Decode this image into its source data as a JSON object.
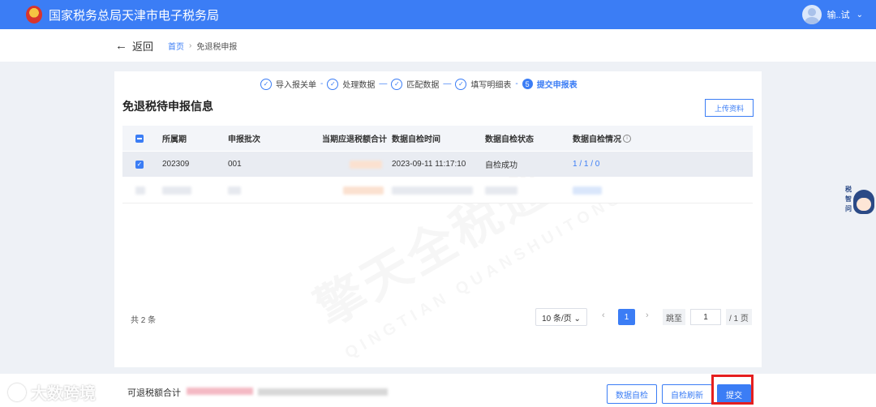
{
  "header": {
    "site_title": "国家税务总局天津市电子税务局",
    "user_name": "输..试",
    "chevron": "⌄"
  },
  "nav": {
    "back_label": "返回",
    "back_arrow": "←",
    "breadcrumb_home": "首页",
    "breadcrumb_sep": "›",
    "breadcrumb_current": "免退税申报"
  },
  "steps": [
    {
      "label": "导入报关单",
      "state": "done"
    },
    {
      "label": "处理数据",
      "state": "done"
    },
    {
      "label": "匹配数据",
      "state": "done"
    },
    {
      "label": "填写明细表",
      "state": "done"
    },
    {
      "label": "提交申报表",
      "state": "active",
      "number": "5"
    }
  ],
  "panel": {
    "title": "免退税待申报信息",
    "upload_button": "上传资料"
  },
  "table": {
    "headers": [
      "所属期",
      "申报批次",
      "当期应退税额合计",
      "数据自检时间",
      "数据自检状态",
      "数据自检情况"
    ],
    "rows": [
      {
        "period": "202309",
        "batch": "001",
        "amount": "",
        "check_time": "2023-09-11 11:17:10",
        "check_status": "自检成功",
        "check_detail": "1 / 1 / 0"
      }
    ]
  },
  "watermark": {
    "main": "擎天全税通",
    "sub": "QINGTIAN QUANSHUITONG"
  },
  "pagination": {
    "total": "共 2 条",
    "page_size": "10 条/页 ⌄",
    "prev": "‹",
    "next": "›",
    "current_page": "1",
    "jump_label": "跳至",
    "jump_value": "1",
    "page_total": "/ 1 页"
  },
  "helper": {
    "chars": [
      "税",
      "智",
      "问"
    ]
  },
  "footer": {
    "logo_text": "大数跨境",
    "refund_label": "可退税额合计",
    "self_check_button": "数据自检",
    "refresh_button": "自检刷新",
    "submit_button": "提交"
  },
  "colors": {
    "primary": "#3b7df5",
    "highlight": "#e51f1f"
  }
}
